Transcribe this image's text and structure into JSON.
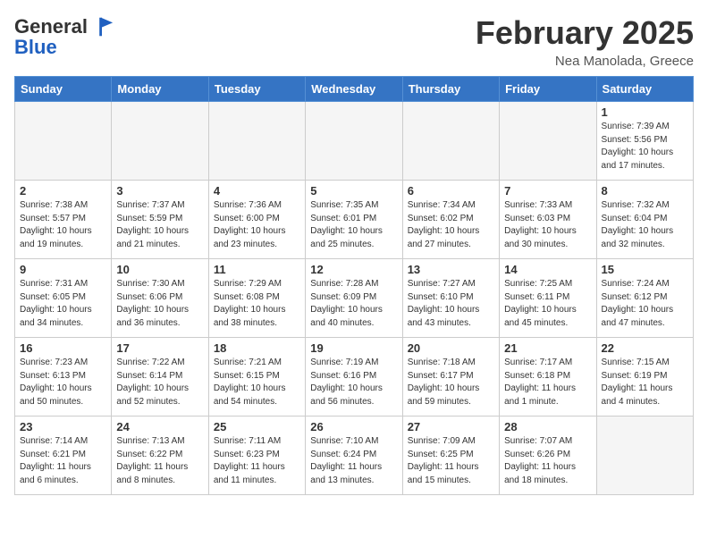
{
  "logo": {
    "general": "General",
    "blue": "Blue"
  },
  "title": "February 2025",
  "subtitle": "Nea Manolada, Greece",
  "days_of_week": [
    "Sunday",
    "Monday",
    "Tuesday",
    "Wednesday",
    "Thursday",
    "Friday",
    "Saturday"
  ],
  "weeks": [
    [
      {
        "day": "",
        "info": ""
      },
      {
        "day": "",
        "info": ""
      },
      {
        "day": "",
        "info": ""
      },
      {
        "day": "",
        "info": ""
      },
      {
        "day": "",
        "info": ""
      },
      {
        "day": "",
        "info": ""
      },
      {
        "day": "1",
        "info": "Sunrise: 7:39 AM\nSunset: 5:56 PM\nDaylight: 10 hours\nand 17 minutes."
      }
    ],
    [
      {
        "day": "2",
        "info": "Sunrise: 7:38 AM\nSunset: 5:57 PM\nDaylight: 10 hours\nand 19 minutes."
      },
      {
        "day": "3",
        "info": "Sunrise: 7:37 AM\nSunset: 5:59 PM\nDaylight: 10 hours\nand 21 minutes."
      },
      {
        "day": "4",
        "info": "Sunrise: 7:36 AM\nSunset: 6:00 PM\nDaylight: 10 hours\nand 23 minutes."
      },
      {
        "day": "5",
        "info": "Sunrise: 7:35 AM\nSunset: 6:01 PM\nDaylight: 10 hours\nand 25 minutes."
      },
      {
        "day": "6",
        "info": "Sunrise: 7:34 AM\nSunset: 6:02 PM\nDaylight: 10 hours\nand 27 minutes."
      },
      {
        "day": "7",
        "info": "Sunrise: 7:33 AM\nSunset: 6:03 PM\nDaylight: 10 hours\nand 30 minutes."
      },
      {
        "day": "8",
        "info": "Sunrise: 7:32 AM\nSunset: 6:04 PM\nDaylight: 10 hours\nand 32 minutes."
      }
    ],
    [
      {
        "day": "9",
        "info": "Sunrise: 7:31 AM\nSunset: 6:05 PM\nDaylight: 10 hours\nand 34 minutes."
      },
      {
        "day": "10",
        "info": "Sunrise: 7:30 AM\nSunset: 6:06 PM\nDaylight: 10 hours\nand 36 minutes."
      },
      {
        "day": "11",
        "info": "Sunrise: 7:29 AM\nSunset: 6:08 PM\nDaylight: 10 hours\nand 38 minutes."
      },
      {
        "day": "12",
        "info": "Sunrise: 7:28 AM\nSunset: 6:09 PM\nDaylight: 10 hours\nand 40 minutes."
      },
      {
        "day": "13",
        "info": "Sunrise: 7:27 AM\nSunset: 6:10 PM\nDaylight: 10 hours\nand 43 minutes."
      },
      {
        "day": "14",
        "info": "Sunrise: 7:25 AM\nSunset: 6:11 PM\nDaylight: 10 hours\nand 45 minutes."
      },
      {
        "day": "15",
        "info": "Sunrise: 7:24 AM\nSunset: 6:12 PM\nDaylight: 10 hours\nand 47 minutes."
      }
    ],
    [
      {
        "day": "16",
        "info": "Sunrise: 7:23 AM\nSunset: 6:13 PM\nDaylight: 10 hours\nand 50 minutes."
      },
      {
        "day": "17",
        "info": "Sunrise: 7:22 AM\nSunset: 6:14 PM\nDaylight: 10 hours\nand 52 minutes."
      },
      {
        "day": "18",
        "info": "Sunrise: 7:21 AM\nSunset: 6:15 PM\nDaylight: 10 hours\nand 54 minutes."
      },
      {
        "day": "19",
        "info": "Sunrise: 7:19 AM\nSunset: 6:16 PM\nDaylight: 10 hours\nand 56 minutes."
      },
      {
        "day": "20",
        "info": "Sunrise: 7:18 AM\nSunset: 6:17 PM\nDaylight: 10 hours\nand 59 minutes."
      },
      {
        "day": "21",
        "info": "Sunrise: 7:17 AM\nSunset: 6:18 PM\nDaylight: 11 hours\nand 1 minute."
      },
      {
        "day": "22",
        "info": "Sunrise: 7:15 AM\nSunset: 6:19 PM\nDaylight: 11 hours\nand 4 minutes."
      }
    ],
    [
      {
        "day": "23",
        "info": "Sunrise: 7:14 AM\nSunset: 6:21 PM\nDaylight: 11 hours\nand 6 minutes."
      },
      {
        "day": "24",
        "info": "Sunrise: 7:13 AM\nSunset: 6:22 PM\nDaylight: 11 hours\nand 8 minutes."
      },
      {
        "day": "25",
        "info": "Sunrise: 7:11 AM\nSunset: 6:23 PM\nDaylight: 11 hours\nand 11 minutes."
      },
      {
        "day": "26",
        "info": "Sunrise: 7:10 AM\nSunset: 6:24 PM\nDaylight: 11 hours\nand 13 minutes."
      },
      {
        "day": "27",
        "info": "Sunrise: 7:09 AM\nSunset: 6:25 PM\nDaylight: 11 hours\nand 15 minutes."
      },
      {
        "day": "28",
        "info": "Sunrise: 7:07 AM\nSunset: 6:26 PM\nDaylight: 11 hours\nand 18 minutes."
      },
      {
        "day": "",
        "info": ""
      }
    ]
  ]
}
